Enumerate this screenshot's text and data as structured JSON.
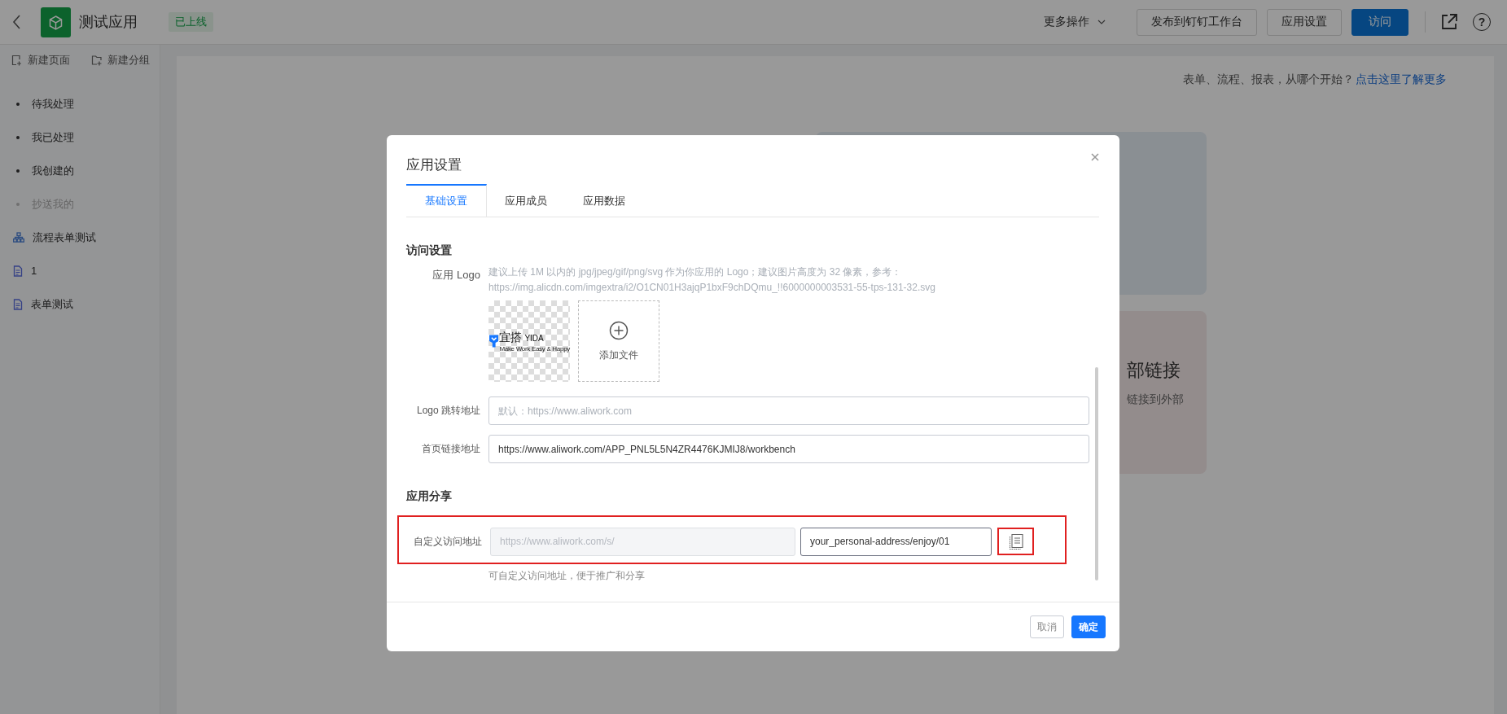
{
  "topbar": {
    "app_name": "测试应用",
    "status_badge": "已上线",
    "more_menu": "更多操作",
    "help": "?",
    "buttons": [
      {
        "label": "发布到钉钉工作台",
        "kind": "default"
      },
      {
        "label": "应用设置",
        "kind": "default"
      },
      {
        "label": "访问",
        "kind": "primary"
      }
    ]
  },
  "sidebar": {
    "actions": [
      {
        "label": "新建页面",
        "kind": "page"
      },
      {
        "label": "新建分组",
        "kind": "folder"
      }
    ],
    "items": [
      {
        "label": "待我处理",
        "kind": "bullet",
        "disabled": false
      },
      {
        "label": "我已处理",
        "kind": "bullet",
        "disabled": false
      },
      {
        "label": "我创建的",
        "kind": "bullet",
        "disabled": false
      },
      {
        "label": "抄送我的",
        "kind": "bullet",
        "disabled": true
      },
      {
        "label": "流程表单测试",
        "kind": "flow",
        "disabled": false
      },
      {
        "label": "1",
        "kind": "page",
        "disabled": false
      },
      {
        "label": "表单测试",
        "kind": "page",
        "disabled": false
      }
    ]
  },
  "main": {
    "intro": "表单、流程、报表，从哪个开始？",
    "intro_link": "点击这里了解更多",
    "cards": [
      {
        "kind": "blue"
      },
      {
        "kind": "pink",
        "title": "部链接",
        "text": "链接到外部"
      }
    ]
  },
  "modal": {
    "title": "应用设置",
    "tabs": [
      {
        "label": "基础设置",
        "selected": true
      },
      {
        "label": "应用成员",
        "selected": false
      },
      {
        "label": "应用数据",
        "selected": false
      }
    ],
    "sections": [
      {
        "title": "访问设置",
        "fields": [
          {
            "kind": "logo",
            "label": "应用 Logo",
            "hint": "建议上传 1M 以内的 jpg/jpeg/gif/png/svg 作为你应用的 Logo；建议图片高度为 32 像素，参考：https://img.alicdn.com/imgextra/i2/O1CN01H3ajqP1bxF9chDQmu_!!6000000003531-55-tps-131-32.svg",
            "preview": {
              "name": "宜搭",
              "name_latin": "YIDA",
              "tagline": "Make Work Easy & Happy"
            },
            "upload": "添加文件"
          },
          {
            "kind": "input",
            "label": "Logo 跳转地址",
            "placeholder": "默认：https://www.aliwork.com"
          },
          {
            "kind": "input",
            "label": "首页链接地址",
            "value": "https://www.aliwork.com/APP_PNL5L5N4ZR4476KJMIJ8/workbench"
          }
        ]
      },
      {
        "title": "应用分享",
        "fields": [
          {
            "kind": "custom_url",
            "label": "自定义访问地址",
            "highlighted": true,
            "copy_highlighted": true,
            "prefix": "https://www.aliwork.com/s/",
            "value": "your_personal-address/enjoy/01",
            "help": "可自定义访问地址，便于推广和分享"
          }
        ]
      }
    ],
    "footer": {
      "cancel": "取消",
      "confirm": "确定"
    }
  }
}
